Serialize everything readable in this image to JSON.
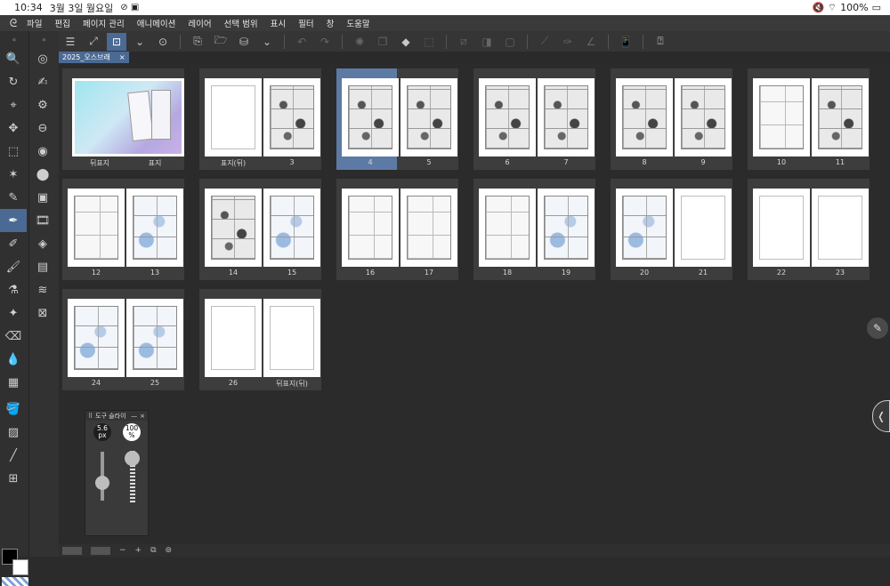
{
  "status": {
    "time": "10:34",
    "date": "3월 3일 월요일",
    "icons": "⊘ ▣",
    "right_icons": "🔇 ⌔",
    "battery": "100%"
  },
  "menu": [
    "파일",
    "편집",
    "페이지 관리",
    "애니메이션",
    "레이어",
    "선택 범위",
    "표시",
    "필터",
    "창",
    "도움말"
  ],
  "document_tab": {
    "title": "2025_오스브래",
    "close": "×"
  },
  "spreads": [
    {
      "left_label": "뒤표지",
      "right_label": "표지",
      "type": "cover"
    },
    {
      "left_label": "표지(뒤)",
      "right_label": "3",
      "type": "blank-comic"
    },
    {
      "left_label": "4",
      "right_label": "5",
      "type": "comic",
      "selected": true
    },
    {
      "left_label": "6",
      "right_label": "7",
      "type": "comic"
    },
    {
      "left_label": "8",
      "right_label": "9",
      "type": "comic"
    },
    {
      "left_label": "10",
      "right_label": "11",
      "type": "comic"
    },
    {
      "left_label": "12",
      "right_label": "13",
      "type": "comic-blue"
    },
    {
      "left_label": "14",
      "right_label": "15",
      "type": "comic-blue"
    },
    {
      "left_label": "16",
      "right_label": "17",
      "type": "light"
    },
    {
      "left_label": "18",
      "right_label": "19",
      "type": "light-blue"
    },
    {
      "left_label": "20",
      "right_label": "21",
      "type": "blue-blank"
    },
    {
      "left_label": "22",
      "right_label": "23",
      "type": "blank"
    },
    {
      "left_label": "24",
      "right_label": "25",
      "type": "comic-blue"
    },
    {
      "left_label": "26",
      "right_label": "뒤표지(뒤)",
      "type": "blank"
    }
  ],
  "tool_size_panel": {
    "title": "도구 슬라이",
    "size_value": "5.6",
    "size_unit": "px",
    "opacity_value": "100",
    "opacity_unit": "%",
    "close": "×",
    "minimize": "—"
  },
  "bottom": {
    "minus": "−",
    "plus": "+"
  },
  "colors": {
    "accent": "#4b6a93",
    "background": "#2b2b2b",
    "foreground_color": "#000000",
    "background_color": "#ffffff"
  }
}
